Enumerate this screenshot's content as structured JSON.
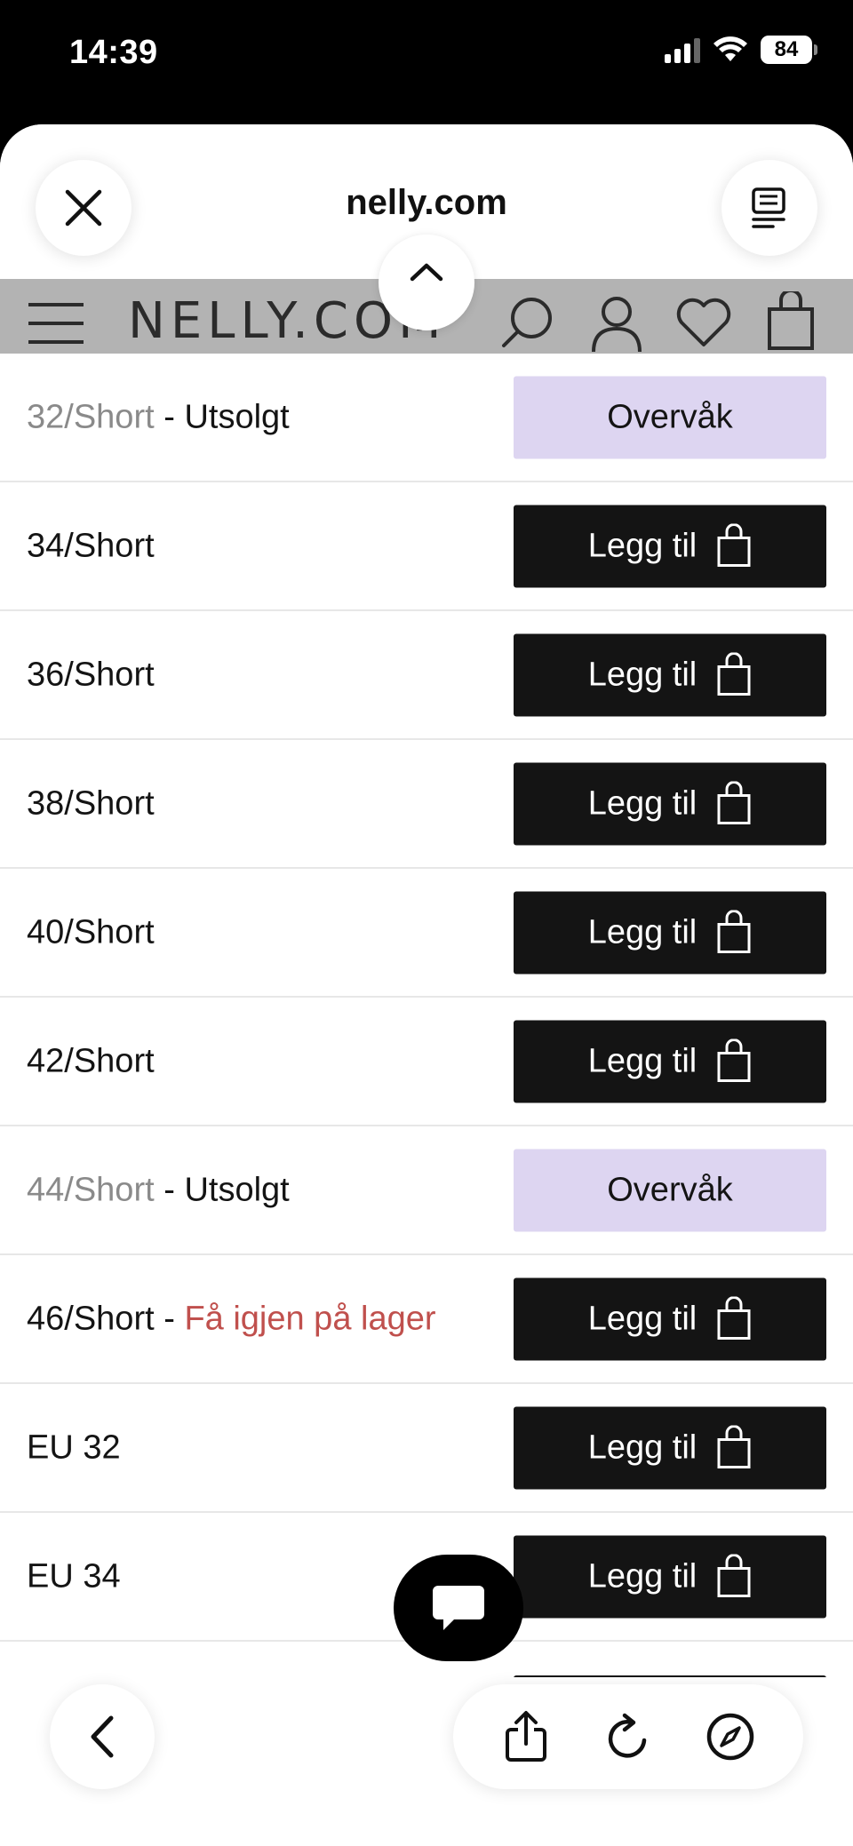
{
  "status_bar": {
    "time": "14:39",
    "battery": "84",
    "icons": [
      "signal-icon",
      "wifi-icon",
      "battery-icon"
    ]
  },
  "sheet": {
    "url": "nelly.com",
    "close_icon": "close-icon",
    "reader_icon": "reader-icon"
  },
  "nav": {
    "logo": "NELLY.COM",
    "icons": [
      "hamburger-menu-icon",
      "search-icon",
      "account-icon",
      "heart-icon",
      "bag-icon",
      "chevron-up-icon"
    ]
  },
  "sizes": [
    {
      "size": "32/Short",
      "status": "Utsolgt",
      "status_type": "soldout",
      "button": "Overvåk",
      "button_type": "watch"
    },
    {
      "size": "34/Short",
      "status": "",
      "status_type": "",
      "button": "Legg til",
      "button_type": "add"
    },
    {
      "size": "36/Short",
      "status": "",
      "status_type": "",
      "button": "Legg til",
      "button_type": "add"
    },
    {
      "size": "38/Short",
      "status": "",
      "status_type": "",
      "button": "Legg til",
      "button_type": "add"
    },
    {
      "size": "40/Short",
      "status": "",
      "status_type": "",
      "button": "Legg til",
      "button_type": "add"
    },
    {
      "size": "42/Short",
      "status": "",
      "status_type": "",
      "button": "Legg til",
      "button_type": "add"
    },
    {
      "size": "44/Short",
      "status": "Utsolgt",
      "status_type": "soldout",
      "button": "Overvåk",
      "button_type": "watch"
    },
    {
      "size": "46/Short",
      "status": "Få igjen på lager",
      "status_type": "low",
      "button": "Legg til",
      "button_type": "add"
    },
    {
      "size": "EU 32",
      "status": "",
      "status_type": "",
      "button": "Legg til",
      "button_type": "add"
    },
    {
      "size": "EU 34",
      "status": "",
      "status_type": "",
      "button": "Legg til",
      "button_type": "add"
    }
  ],
  "colors": {
    "add_button": "#141414",
    "watch_button": "#ddd5f1",
    "low_stock_text": "#c0504d",
    "muted_text": "#8a8a8a"
  },
  "toolbar": {
    "icons": [
      "back-icon",
      "share-icon",
      "reload-icon",
      "compass-icon"
    ]
  },
  "chat": {
    "icon": "chat-bubble-icon"
  }
}
